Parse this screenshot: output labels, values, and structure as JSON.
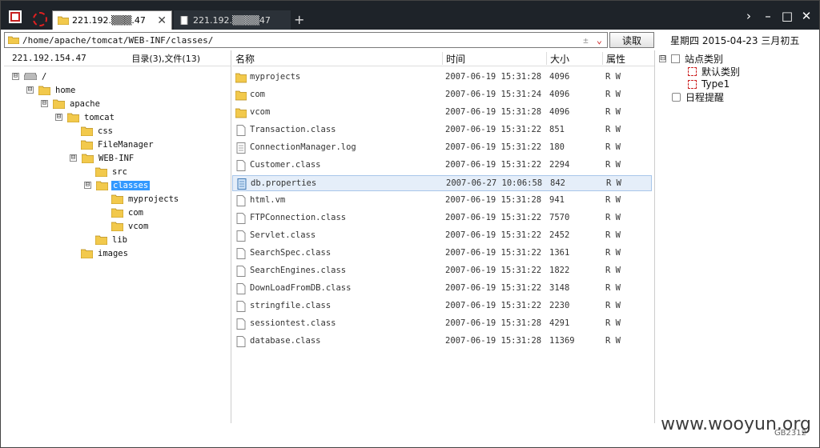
{
  "tabs": [
    {
      "label": "221.192.▒▒▒.47",
      "active": true
    },
    {
      "label": "221.192.▒▒▒▒47",
      "active": false
    }
  ],
  "new_tab_symbol": "+",
  "window_controls": [
    "›",
    "–",
    "□",
    "✕"
  ],
  "address": {
    "path": "/home/apache/tomcat/WEB-INF/classes/",
    "plusminus": "±",
    "read_button": "读取"
  },
  "date_label": "星期四 2015-04-23 三月初五",
  "left_header": {
    "ip": "221.192.154.47",
    "summary": "目录(3),文件(13)"
  },
  "tree": [
    {
      "label": "/",
      "icon": "drive-icon",
      "toggle": "⊟"
    },
    {
      "label": "home",
      "toggle": "⊟"
    },
    {
      "label": "apache",
      "toggle": "⊟"
    },
    {
      "label": "tomcat",
      "toggle": "⊟"
    },
    {
      "label": "css"
    },
    {
      "label": "FileManager"
    },
    {
      "label": "WEB-INF",
      "toggle": "⊟"
    },
    {
      "label": "src"
    },
    {
      "label": "classes",
      "toggle": "⊟",
      "selected": true
    },
    {
      "label": "myprojects"
    },
    {
      "label": "com"
    },
    {
      "label": "vcom"
    },
    {
      "label": "lib"
    },
    {
      "label": "images"
    }
  ],
  "columns": {
    "name": "名称",
    "time": "时间",
    "size": "大小",
    "attr": "属性"
  },
  "files": [
    {
      "name": "myprojects",
      "time": "2007-06-19 15:31:28",
      "size": "4096",
      "attr": "R W",
      "type": "folder"
    },
    {
      "name": "com",
      "time": "2007-06-19 15:31:24",
      "size": "4096",
      "attr": "R W",
      "type": "folder"
    },
    {
      "name": "vcom",
      "time": "2007-06-19 15:31:28",
      "size": "4096",
      "attr": "R W",
      "type": "folder"
    },
    {
      "name": "Transaction.class",
      "time": "2007-06-19 15:31:22",
      "size": "851",
      "attr": "R W",
      "type": "file"
    },
    {
      "name": "ConnectionManager.log",
      "time": "2007-06-19 15:31:22",
      "size": "180",
      "attr": "R W",
      "type": "text"
    },
    {
      "name": "Customer.class",
      "time": "2007-06-19 15:31:22",
      "size": "2294",
      "attr": "R W",
      "type": "file"
    },
    {
      "name": "db.properties",
      "time": "2007-06-27 10:06:58",
      "size": "842",
      "attr": "R W",
      "type": "props",
      "selected": true
    },
    {
      "name": "html.vm",
      "time": "2007-06-19 15:31:28",
      "size": "941",
      "attr": "R W",
      "type": "file"
    },
    {
      "name": "FTPConnection.class",
      "time": "2007-06-19 15:31:22",
      "size": "7570",
      "attr": "R W",
      "type": "file"
    },
    {
      "name": "Servlet.class",
      "time": "2007-06-19 15:31:22",
      "size": "2452",
      "attr": "R W",
      "type": "file"
    },
    {
      "name": "SearchSpec.class",
      "time": "2007-06-19 15:31:22",
      "size": "1361",
      "attr": "R W",
      "type": "file"
    },
    {
      "name": "SearchEngines.class",
      "time": "2007-06-19 15:31:22",
      "size": "1822",
      "attr": "R W",
      "type": "file"
    },
    {
      "name": "DownLoadFromDB.class",
      "time": "2007-06-19 15:31:22",
      "size": "3148",
      "attr": "R W",
      "type": "file"
    },
    {
      "name": "stringfile.class",
      "time": "2007-06-19 15:31:22",
      "size": "2230",
      "attr": "R W",
      "type": "file"
    },
    {
      "name": "sessiontest.class",
      "time": "2007-06-19 15:31:28",
      "size": "4291",
      "attr": "R W",
      "type": "file"
    },
    {
      "name": "database.class",
      "time": "2007-06-19 15:31:28",
      "size": "11369",
      "attr": "R W",
      "type": "file"
    }
  ],
  "site_tree": {
    "root": "站点类别",
    "root_toggle": "⊟",
    "children": [
      "默认类别",
      "Type1"
    ],
    "reminder": "日程提醒"
  },
  "watermark": "www.wooyun.org",
  "encoding": "GB2312",
  "colors": {
    "titlebar": "#1e2329",
    "selection": "#3399ff",
    "row_selection": "#e5eef9",
    "folder": "#f2c94c"
  }
}
